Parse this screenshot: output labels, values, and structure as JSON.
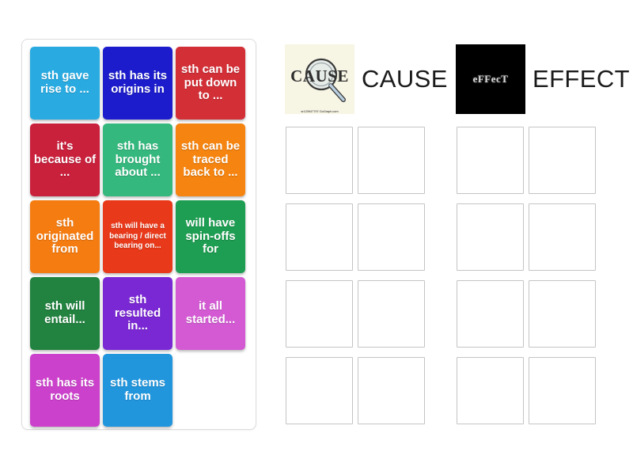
{
  "activity": {
    "type": "group-sort",
    "background_color": "#ffffff"
  },
  "tray": {
    "name": "draggable-tiles-tray",
    "tiles": [
      {
        "label": "sth gave rise to ...",
        "color": "#29abe2",
        "text_size": "normal"
      },
      {
        "label": "sth has its origins in",
        "color": "#1c1ccc",
        "text_size": "normal"
      },
      {
        "label": "sth can be put down to ...",
        "color": "#d32f37",
        "text_size": "normal"
      },
      {
        "label": "it's because of ...",
        "color": "#c9203c",
        "text_size": "normal"
      },
      {
        "label": "sth has brought about ...",
        "color": "#35b87e",
        "text_size": "normal"
      },
      {
        "label": "sth can be traced back to ...",
        "color": "#f58410",
        "text_size": "normal"
      },
      {
        "label": "sth originated from",
        "color": "#f57c11",
        "text_size": "normal"
      },
      {
        "label": "sth will have a bearing / direct bearing on...",
        "color": "#e8391a",
        "text_size": "small"
      },
      {
        "label": "will have spin-offs for",
        "color": "#1e9e52",
        "text_size": "normal"
      },
      {
        "label": "sth will entail...",
        "color": "#22823f",
        "text_size": "normal"
      },
      {
        "label": "sth resulted in...",
        "color": "#7a28d4",
        "text_size": "normal"
      },
      {
        "label": "it all started...",
        "color": "#d35ad3",
        "text_size": "normal"
      },
      {
        "label": "sth has its roots",
        "color": "#cc41cc",
        "text_size": "normal"
      },
      {
        "label": "sth stems from",
        "color": "#2196dd",
        "text_size": "normal"
      }
    ]
  },
  "groups": [
    {
      "id": "cause",
      "title": "CAUSE",
      "thumbnail": {
        "icon": "magnifying-glass-cause-image",
        "word": "CAUSE",
        "background": "#f7f5e4",
        "watermark": "sr120947797 GoGraph.com"
      },
      "slot_count": 8
    },
    {
      "id": "effect",
      "title": "EFFECT",
      "thumbnail": {
        "icon": "effect-black-image",
        "word": "eFFecT",
        "background": "#000000",
        "watermark": ""
      },
      "slot_count": 8
    }
  ]
}
